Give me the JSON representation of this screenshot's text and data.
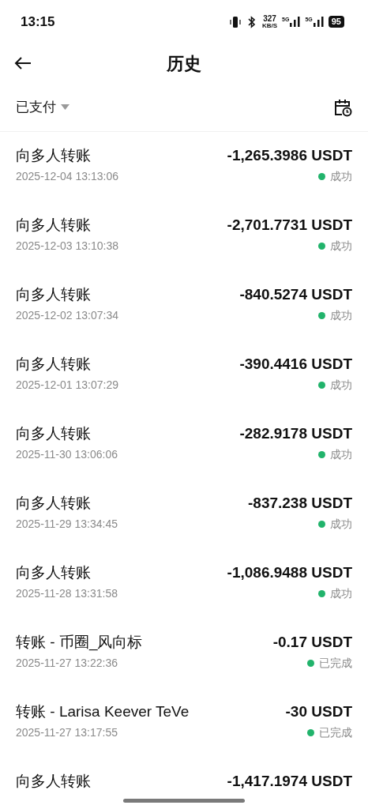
{
  "status_bar": {
    "time": "13:15",
    "net_speed": "327",
    "net_unit": "KB/S",
    "sim_1": "5G",
    "sim_2": "5G",
    "battery": "95"
  },
  "header": {
    "title": "历史"
  },
  "filter": {
    "label": "已支付"
  },
  "transactions": [
    {
      "title": "向多人转账",
      "date": "2025-12-04 13:13:06",
      "amount": "-1,265.3986 USDT",
      "status": "成功"
    },
    {
      "title": "向多人转账",
      "date": "2025-12-03 13:10:38",
      "amount": "-2,701.7731 USDT",
      "status": "成功"
    },
    {
      "title": "向多人转账",
      "date": "2025-12-02 13:07:34",
      "amount": "-840.5274 USDT",
      "status": "成功"
    },
    {
      "title": "向多人转账",
      "date": "2025-12-01 13:07:29",
      "amount": "-390.4416 USDT",
      "status": "成功"
    },
    {
      "title": "向多人转账",
      "date": "2025-11-30 13:06:06",
      "amount": "-282.9178 USDT",
      "status": "成功"
    },
    {
      "title": "向多人转账",
      "date": "2025-11-29 13:34:45",
      "amount": "-837.238 USDT",
      "status": "成功"
    },
    {
      "title": "向多人转账",
      "date": "2025-11-28 13:31:58",
      "amount": "-1,086.9488 USDT",
      "status": "成功"
    },
    {
      "title": "转账 - 币圈_风向标",
      "date": "2025-11-27 13:22:36",
      "amount": "-0.17 USDT",
      "status": "已完成"
    },
    {
      "title": "转账 - Larisa Keever TeVe",
      "date": "2025-11-27 13:17:55",
      "amount": "-30 USDT",
      "status": "已完成"
    },
    {
      "title": "向多人转账",
      "amount": "-1,417.1974 USDT"
    }
  ]
}
